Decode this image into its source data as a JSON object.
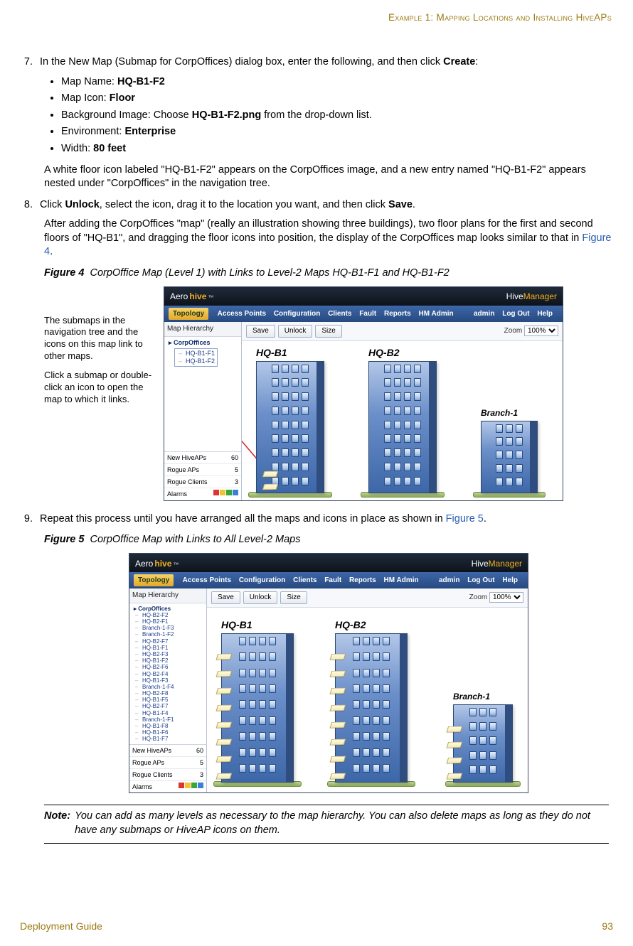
{
  "runningHead": "Example 1: Mapping Locations and Installing HiveAPs",
  "step7": {
    "lead_a": "In the New Map (Submap for CorpOffices) dialog box, enter the following, and then click ",
    "lead_b": "Create",
    "lead_c": ":",
    "props": [
      {
        "pre": "Map Name: ",
        "bold": "HQ-B1-F2"
      },
      {
        "pre": "Map Icon: ",
        "bold": "Floor"
      },
      {
        "pre": "Background Image: Choose ",
        "bold": "HQ-B1-F2.png",
        "post": " from the drop-down list."
      },
      {
        "pre": "Environment: ",
        "bold": "Enterprise"
      },
      {
        "pre": "Width: ",
        "bold": "80 feet"
      }
    ],
    "follow": "A white floor icon labeled \"HQ-B1-F2\" appears on the CorpOffices image, and a new entry named \"HQ-B1-F2\" appears nested under \"CorpOffices\" in the navigation tree."
  },
  "step8": {
    "a": "Click ",
    "unlock": "Unlock",
    "b": ", select the icon, drag it to the location you want, and then click ",
    "save": "Save",
    "c": ".",
    "follow_a": "After adding the CorpOffices \"map\" (really an illustration showing three buildings), two floor plans for the first and second floors of \"HQ-B1\", and dragging the floor icons into position, the display of the CorpOffices map looks similar to that in ",
    "follow_link": "Figure 4",
    "follow_b": "."
  },
  "fig4_caption_no": "Figure 4",
  "fig4_caption_title": "CorpOffice Map (Level 1) with Links to Level-2 Maps HQ-B1-F1 and HQ-B1-F2",
  "aside1": "The submaps in the navigation tree and the icons on this map link to other maps.",
  "aside2": "Click a submap or double-click an icon to open the map to which it links.",
  "hm": {
    "logo_a": "Aero",
    "logo_b": "hive",
    "tm": "™",
    "product_a": "Hive",
    "product_b": "Manager",
    "nav_left": [
      "Topology",
      "Access Points",
      "Configuration",
      "Clients",
      "Fault",
      "Reports",
      "HM Admin"
    ],
    "nav_right": [
      "admin",
      "Log Out",
      "Help"
    ],
    "side_hdr": "Map Hierarchy",
    "btn_save": "Save",
    "btn_unlock": "Unlock",
    "btn_size": "Size",
    "zoom_label": "Zoom",
    "zoom_val": "100%",
    "b1": "HQ-B1",
    "b2": "HQ-B2",
    "branch": "Branch-1",
    "stats": {
      "new_label": "New HiveAPs",
      "new_val": "60",
      "rap_label": "Rogue APs",
      "rap_val": "5",
      "rcl_label": "Rogue Clients",
      "rcl_val": "3",
      "al_label": "Alarms"
    }
  },
  "tree4": {
    "root": "CorpOffices",
    "boxed": [
      "HQ-B1-F1",
      "HQ-B1-F2"
    ]
  },
  "tree5": {
    "root": "CorpOffices",
    "items": [
      "HQ-B2-F2",
      "HQ-B2-F1",
      "Branch-1-F3",
      "Branch-1-F2",
      "HQ-B2-F7",
      "HQ-B1-F1",
      "HQ-B2-F3",
      "HQ-B1-F2",
      "HQ-B2-F6",
      "HQ-B2-F4",
      "HQ-B1-F3",
      "Branch-1-F4",
      "HQ-B2-F8",
      "HQ-B1-F5",
      "HQ-B2-F7",
      "HQ-B1-F4",
      "Branch-1-F1",
      "HQ-B1-F8",
      "HQ-B1-F6",
      "HQ-B1-F7"
    ]
  },
  "step9": {
    "a": "Repeat this process until you have arranged all the maps and icons in place as shown in ",
    "link": "Figure 5",
    "b": "."
  },
  "fig5_caption_no": "Figure 5",
  "fig5_caption_title": "CorpOffice Map with Links to All Level-2 Maps",
  "note_label": "Note:",
  "note_text": "You can add as many levels as necessary to the map hierarchy. You can also delete maps as long as they do not have any submaps or HiveAP icons on them.",
  "footer_left": "Deployment Guide",
  "footer_right": "93"
}
